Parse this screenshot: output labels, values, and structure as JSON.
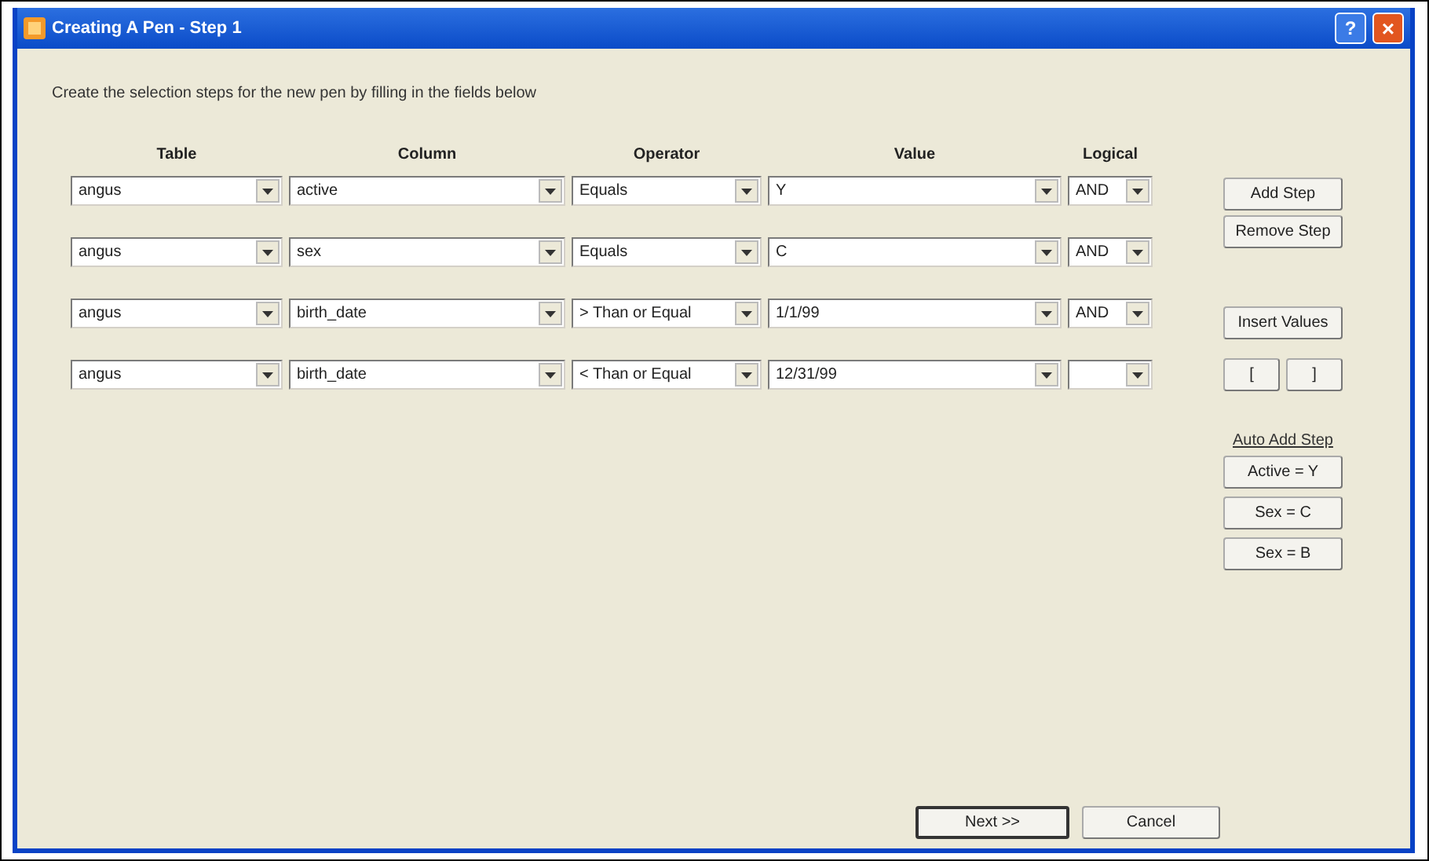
{
  "window": {
    "title": "Creating A Pen - Step 1",
    "help_button": "?",
    "close_button": "×"
  },
  "instruction": "Create the selection steps for the new pen by filling in the fields below",
  "columns": [
    "Table",
    "Column",
    "Operator",
    "Value",
    "Logical"
  ],
  "rows": [
    {
      "table": "angus",
      "column": "active",
      "operator": "Equals",
      "value": "Y",
      "logical": "AND"
    },
    {
      "table": "angus",
      "column": "sex",
      "operator": "Equals",
      "value": "C",
      "logical": "AND"
    },
    {
      "table": "angus",
      "column": "birth_date",
      "operator": "> Than or Equal",
      "value": "1/1/99",
      "logical": "AND"
    },
    {
      "table": "angus",
      "column": "birth_date",
      "operator": "< Than or Equal",
      "value": "12/31/99",
      "logical": ""
    }
  ],
  "step_buttons": [
    "Add Step",
    "Remove Step"
  ],
  "insert_values_button": "Insert Values",
  "bracket_buttons": [
    "[",
    "]"
  ],
  "auto_add_label": "Auto Add Step",
  "auto_add_buttons": [
    "Active = Y",
    "Sex = C",
    "Sex = B"
  ],
  "footer_buttons": [
    {
      "label": "Next >>",
      "default": true
    },
    {
      "label": "Cancel",
      "default": false
    }
  ]
}
